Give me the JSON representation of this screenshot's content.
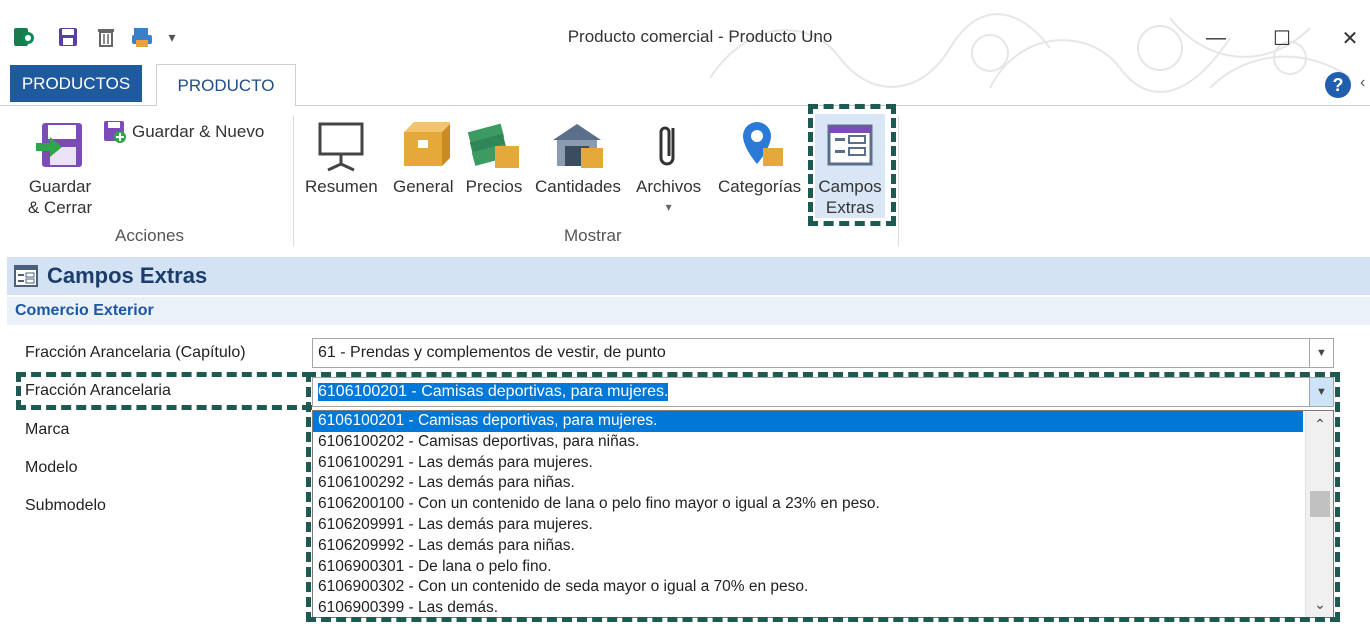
{
  "window": {
    "title": "Producto comercial - Producto Uno",
    "minimize_icon": "minimize-icon",
    "maximize_icon": "maximize-icon",
    "close_icon": "close-icon",
    "minimize_glyph": "—",
    "maximize_glyph": "☐",
    "close_glyph": "✕"
  },
  "quick_access": {
    "icons": [
      "app-icon",
      "save-icon",
      "delete-icon",
      "print-icon",
      "customize-arrow-icon"
    ],
    "customize_glyph": "▾"
  },
  "tabs": {
    "file_tab": "PRODUCTOS",
    "active_tab": "PRODUCTO"
  },
  "help": {
    "glyph": "?",
    "arrow": "‹"
  },
  "ribbon": {
    "acciones": {
      "label": "Acciones",
      "guardar_cerrar_line1": "Guardar",
      "guardar_cerrar_line2": "& Cerrar",
      "guardar_nuevo": "Guardar & Nuevo"
    },
    "mostrar": {
      "label": "Mostrar",
      "resumen": "Resumen",
      "general": "General",
      "precios": "Precios",
      "cantidades": "Cantidades",
      "archivos": "Archivos",
      "archivos_arrow": "▾",
      "categorias": "Categorías",
      "campos_extras_line1": "Campos",
      "campos_extras_line2": "Extras"
    }
  },
  "section": {
    "title": "Campos Extras",
    "subsection": "Comercio Exterior"
  },
  "form": {
    "capitulo_label": "Fracción Arancelaria (Capítulo)",
    "capitulo_value": "61 - Prendas y complementos de vestir, de punto",
    "fraccion_label": "Fracción Arancelaria",
    "fraccion_value": "6106100201 - Camisas deportivas, para mujeres.",
    "marca_label": "Marca",
    "modelo_label": "Modelo",
    "submodelo_label": "Submodelo",
    "dropdown_arrow": "▼"
  },
  "dropdown": {
    "selected_index": 0,
    "items": [
      "6106100201 - Camisas deportivas, para mujeres.",
      "6106100202 - Camisas deportivas, para niñas.",
      "6106100291 - Las demás para mujeres.",
      "6106100292 - Las demás para niñas.",
      "6106200100 - Con un contenido de lana o pelo fino mayor o igual a 23% en peso.",
      "6106209991 - Las demás para mujeres.",
      "6106209992 - Las demás para niñas.",
      "6106900301 - De lana o pelo fino.",
      "6106900302 - Con un contenido de seda mayor o igual a 70% en peso.",
      "6106900399 - Las demás."
    ],
    "scroll_up": "⌃",
    "scroll_down": "⌄"
  },
  "colors": {
    "accent_blue": "#1f5a9e",
    "selection": "#0078d7",
    "highlight_dash": "#1e5a52",
    "section_bg": "#d3e3f3"
  }
}
